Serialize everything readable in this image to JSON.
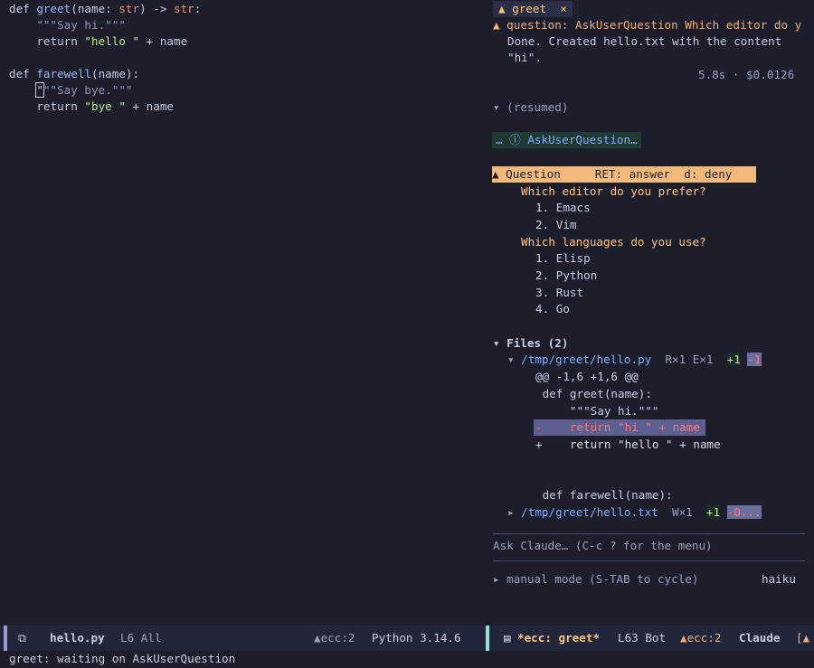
{
  "editor": {
    "code": {
      "l1": {
        "def": "def ",
        "name": "greet",
        "open": "(name: ",
        "type": "str",
        "close": ") -> ",
        "ret": "str",
        "colon": ":"
      },
      "l2": "    \"\"\"Say hi.\"\"\"",
      "l3": {
        "kw": "    return ",
        "str": "\"hello \"",
        "rest": " + name"
      },
      "l5": {
        "def": "def ",
        "name": "farewell",
        "rest": "(name):"
      },
      "l6_cursor": "\"",
      "l6_rest": "\"\"Say bye.\"\"\"",
      "l7": {
        "kw": "    return ",
        "str": "\"bye \"",
        "rest": " + name"
      }
    }
  },
  "claude": {
    "tab_label": "▲ greet  ×",
    "question_line": "▲ question: AskUserQuestion Which editor do y",
    "done_line1": "Done. Created hello.txt with the content",
    "done_line2": "\"hi\".",
    "stats": "5.8s · $0.0126",
    "resumed": "▾ (resumed)",
    "ask_chip": "… ⓘ AskUserQuestion…",
    "question_bar": "▲ Question     RET: answer  d: deny",
    "q1": "Which editor do you prefer?",
    "q1_opts": [
      "1. Emacs",
      "2. Vim"
    ],
    "q2": "Which languages do you use?",
    "q2_opts": [
      "1. Elisp",
      "2. Python",
      "3. Rust",
      "4. Go"
    ],
    "files_header": "▾ Files (2)",
    "file1": {
      "arrow": "▾ ",
      "path": "/tmp/greet/hello.py",
      "meta": "  R×1 E×1  ",
      "plus": "+1",
      "minus": "-1"
    },
    "diff_hunk": "@@ -1,6 +1,6 @@",
    "diff_ctx1": " def greet(name):",
    "diff_ctx2": "     \"\"\"Say hi.\"\"\"",
    "diff_del": "-    return \"hi \" + name",
    "diff_add": "+    return \"hello \" + name",
    "diff_ctx3": " def farewell(name):",
    "file2": {
      "arrow": "▸ ",
      "path": "/tmp/greet/hello.txt",
      "meta": "  W×1  ",
      "plus": "+1",
      "minus": "-0..."
    },
    "prompt_placeholder": "Ask Claude… (C-c ? for the menu)",
    "mode": "▸ manual mode (S-TAB to cycle)",
    "model": "haiku"
  },
  "modeline": {
    "left": {
      "icon": "⧉",
      "file": "hello.py",
      "pos": "L6 All",
      "ecc": "▲ecc:2",
      "lang": "Python 3.14.6"
    },
    "right": {
      "file": "*ecc: greet*",
      "pos": "L63 Bot",
      "ecc": "▲ecc:2",
      "mode": "Claude",
      "extra": "[▲"
    }
  },
  "echo": "greet: waiting on AskUserQuestion",
  "colors": {
    "accent": "#ffc777",
    "question_bg": "#f2b97b",
    "bg": "#1c1e2b"
  }
}
